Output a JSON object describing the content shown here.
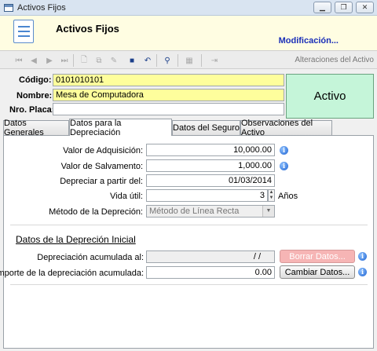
{
  "window": {
    "title": "Activos Fijos"
  },
  "header": {
    "title": "Activos Fijos",
    "mode": "Modificación..."
  },
  "toolbar": {
    "label": "Alteraciones del Activo"
  },
  "asset": {
    "codigo_label": "Código:",
    "codigo_value": "0101010101",
    "nombre_label": "Nombre:",
    "nombre_value": "Mesa de Computadora",
    "placa_label": "Nro. Placa:",
    "placa_value": "",
    "status": "Activo"
  },
  "tabs": [
    "Datos Generales",
    "Datos para la Depreciación",
    "Datos del Seguro",
    "Observaciones del Activo"
  ],
  "depreciation": {
    "valor_adquisicion_label": "Valor de Adquisición:",
    "valor_adquisicion": "10,000.00",
    "valor_salvamento_label": "Valor de Salvamento:",
    "valor_salvamento": "1,000.00",
    "depreciar_label": "Depreciar a partir del:",
    "depreciar_fecha": "01/03/2014",
    "vida_util_label": "Vida útil:",
    "vida_util": "3",
    "vida_util_unit": "Años",
    "metodo_label": "Método de la Depreción:",
    "metodo_value": "Método de Línea Recta"
  },
  "initial": {
    "section_title": "Datos de la Depreción Inicial",
    "acumulada_label": "Depreciación acumulada al:",
    "acumulada_fecha": "/ /",
    "borrar_button": "Borrar Datos...",
    "importe_label": "Importe de la depreciación acumulada:",
    "importe_value": "0.00",
    "cambiar_button": "Cambiar Datos..."
  }
}
